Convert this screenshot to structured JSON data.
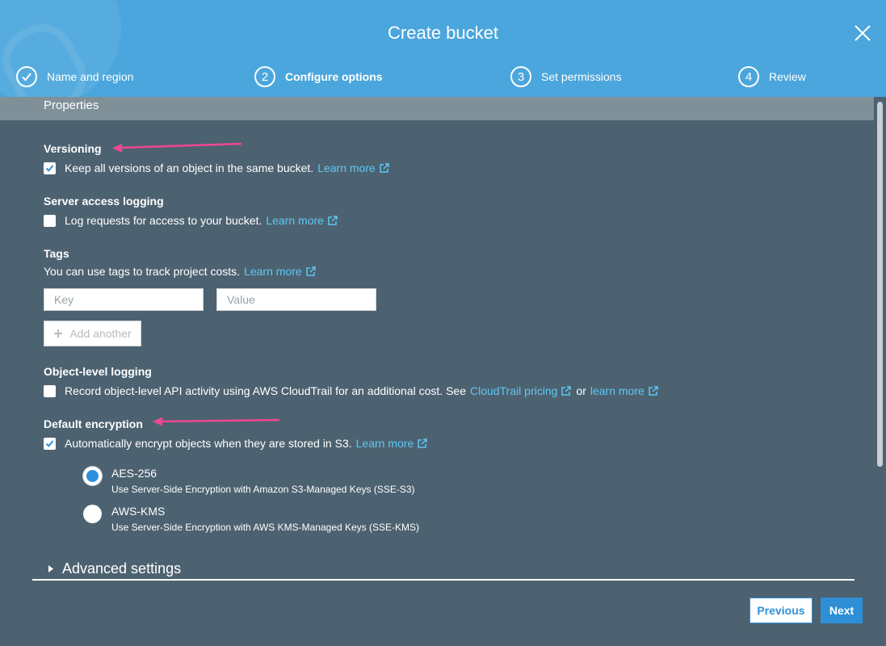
{
  "header": {
    "title": "Create bucket",
    "steps": [
      {
        "number": "✓",
        "label": "Name and region"
      },
      {
        "number": "2",
        "label": "Configure options"
      },
      {
        "number": "3",
        "label": "Set permissions"
      },
      {
        "number": "4",
        "label": "Review"
      }
    ]
  },
  "properties_label": "Properties",
  "versioning": {
    "heading": "Versioning",
    "checked": true,
    "text": "Keep all versions of an object in the same bucket.",
    "link": "Learn more"
  },
  "server_access_logging": {
    "heading": "Server access logging",
    "checked": false,
    "text": "Log requests for access to your bucket.",
    "link": "Learn more"
  },
  "tags": {
    "heading": "Tags",
    "text": "You can use tags to track project costs.",
    "link": "Learn more",
    "key_placeholder": "Key",
    "value_placeholder": "Value",
    "add_label": "Add another"
  },
  "object_level_logging": {
    "heading": "Object-level logging",
    "checked": false,
    "text": "Record object-level API activity using AWS CloudTrail for an additional cost. See",
    "link1": "CloudTrail pricing",
    "or": "or",
    "link2": "learn more"
  },
  "default_encryption": {
    "heading": "Default encryption",
    "checked": true,
    "text": "Automatically encrypt objects when they are stored in S3.",
    "link": "Learn more",
    "options": [
      {
        "title": "AES-256",
        "desc": "Use Server-Side Encryption with Amazon S3-Managed Keys (SSE-S3)",
        "selected": true
      },
      {
        "title": "AWS-KMS",
        "desc": "Use Server-Side Encryption with AWS KMS-Managed Keys (SSE-KMS)",
        "selected": false
      }
    ]
  },
  "advanced_settings": "Advanced settings",
  "footer": {
    "previous": "Previous",
    "next": "Next"
  },
  "colors": {
    "header": "#4aa6dc",
    "panel": "#4d6271",
    "link": "#5dc8f5",
    "primary": "#2e8fd6",
    "annotation_arrow": "#f0478f"
  }
}
